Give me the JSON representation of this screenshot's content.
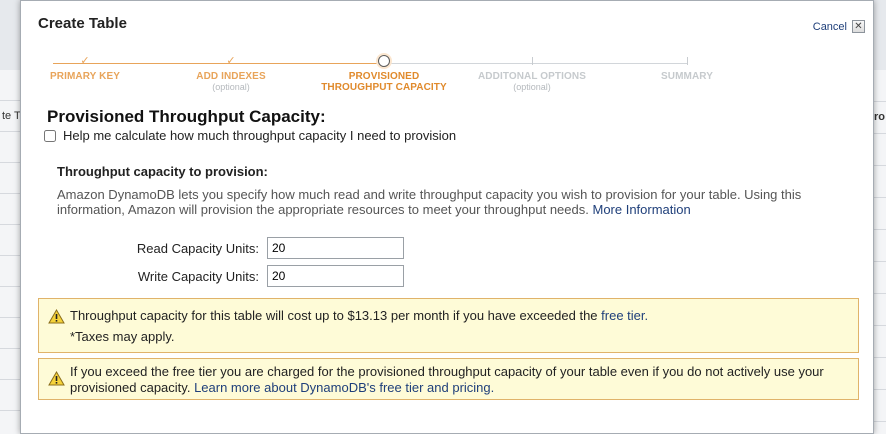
{
  "background": {
    "left_rows": [
      "",
      "te T",
      "",
      "",
      "",
      "",
      "",
      "",
      "",
      "",
      ""
    ],
    "right_rows": [
      "",
      "ro",
      "",
      "",
      "",
      "",
      "",
      "",
      "",
      "",
      ""
    ]
  },
  "modal": {
    "title": "Create Table",
    "cancel_label": "Cancel",
    "close_glyph": "✕"
  },
  "wizard": {
    "steps": [
      {
        "label": "PRIMARY KEY",
        "sub": "",
        "state": "done"
      },
      {
        "label": "ADD INDEXES",
        "sub": "(optional)",
        "state": "done"
      },
      {
        "label1": "PROVISIONED",
        "label2": "THROUGHPUT CAPACITY",
        "state": "current"
      },
      {
        "label": "ADDITONAL OPTIONS",
        "sub": "(optional)",
        "state": "todo"
      },
      {
        "label": "SUMMARY",
        "sub": "",
        "state": "todo"
      }
    ],
    "done_color": "#e8a45a",
    "current_color": "#e08a2c",
    "todo_color": "#c6cacd"
  },
  "content": {
    "section_title": "Provisioned Throughput Capacity:",
    "calc_checkbox_label": "Help me calculate how much throughput capacity I need to provision",
    "calc_checked": false,
    "sub_title": "Throughput capacity to provision:",
    "description": "Amazon DynamoDB lets you specify how much read and write throughput capacity you wish to provision for your table. Using this information, Amazon will provision the appropriate resources to meet your throughput needs.",
    "more_info_link": "More Information",
    "read_label": "Read Capacity Units:",
    "read_value": "20",
    "write_label": "Write Capacity Units:",
    "write_value": "20"
  },
  "warnings": {
    "cost_text": "Throughput capacity for this table will cost up to $13.13 per month if you have exceeded the",
    "cost_link": "free tier.",
    "taxes_note": "*Taxes may apply.",
    "free_tier_text": "If you exceed the free tier you are charged for the provisioned throughput capacity of your table even if you do not actively use your provisioned capacity.",
    "free_tier_link": "Learn more about DynamoDB's free tier and pricing.",
    "icon": "warning-triangle-icon"
  }
}
